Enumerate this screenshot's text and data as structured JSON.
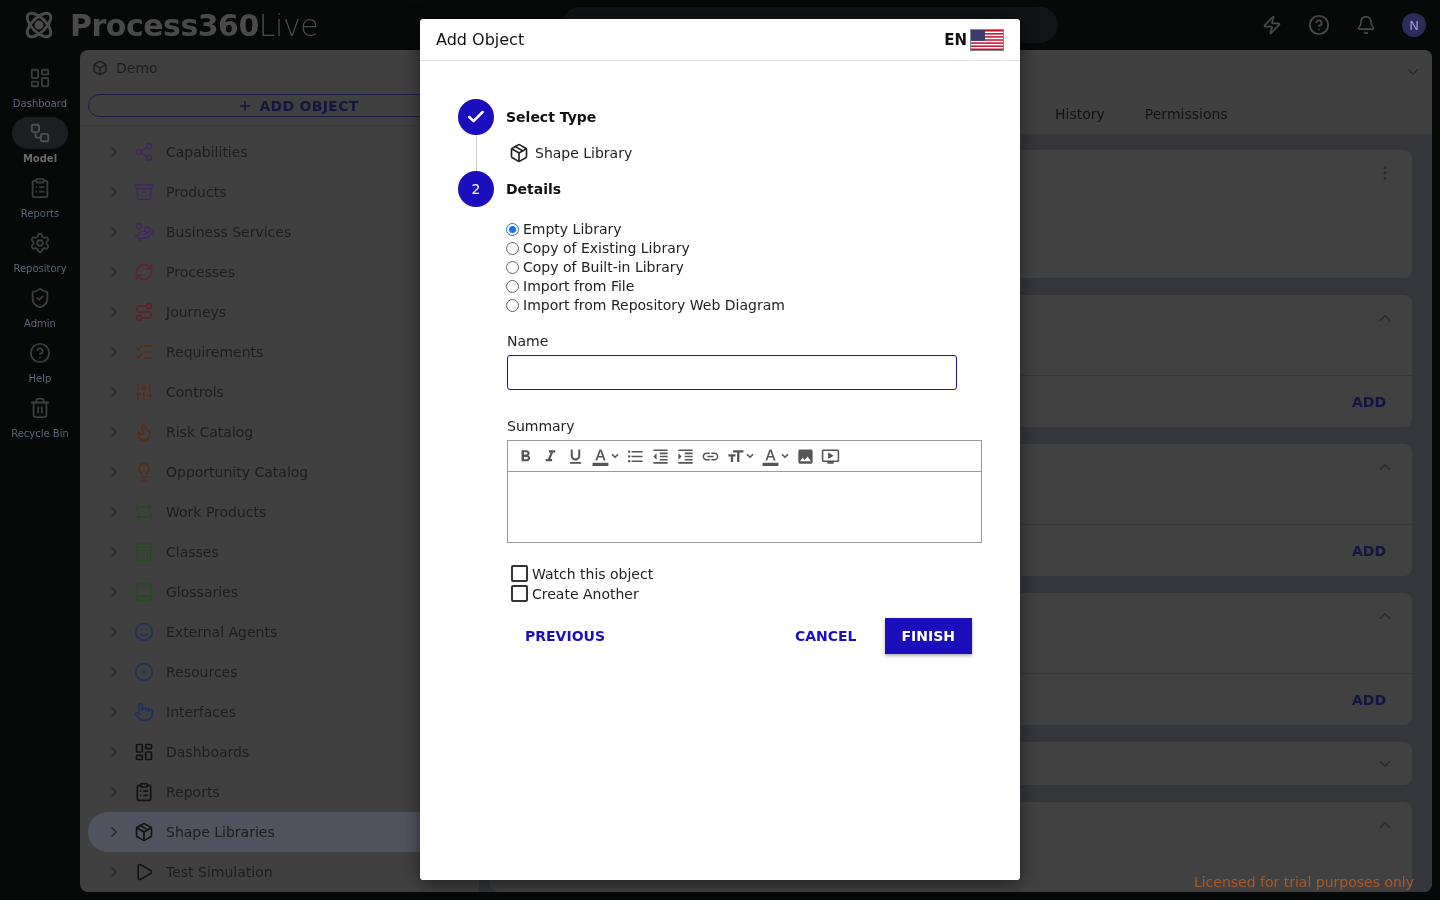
{
  "topbar": {
    "logo": "**Process360**Live",
    "avatar": "N"
  },
  "rail": [
    {
      "label": "Dashboard",
      "selected": false
    },
    {
      "label": "Model",
      "selected": true
    },
    {
      "label": "Reports",
      "selected": false
    },
    {
      "label": "Repository",
      "selected": false
    },
    {
      "label": "Admin",
      "selected": false
    },
    {
      "label": "Help",
      "selected": false
    },
    {
      "label": "Recycle Bin",
      "selected": false
    }
  ],
  "tree": {
    "title": "Demo",
    "add_button": "ADD OBJECT",
    "items": [
      {
        "label": "Capabilities",
        "color": "#3f2a5c",
        "selected": false
      },
      {
        "label": "Products",
        "color": "#3f2a5c",
        "selected": false
      },
      {
        "label": "Business Services",
        "color": "#3f2a5c",
        "selected": false
      },
      {
        "label": "Processes",
        "color": "#5c2230",
        "selected": false
      },
      {
        "label": "Journeys",
        "color": "#5c2230",
        "selected": false
      },
      {
        "label": "Requirements",
        "color": "#5c2a18",
        "selected": false
      },
      {
        "label": "Controls",
        "color": "#5c2a18",
        "selected": false
      },
      {
        "label": "Risk Catalog",
        "color": "#5c2a18",
        "selected": false
      },
      {
        "label": "Opportunity Catalog",
        "color": "#5c2a18",
        "selected": false
      },
      {
        "label": "Work Products",
        "color": "#244a20",
        "selected": false
      },
      {
        "label": "Classes",
        "color": "#244a20",
        "selected": false
      },
      {
        "label": "Glossaries",
        "color": "#244a20",
        "selected": false
      },
      {
        "label": "External Agents",
        "color": "#22305c",
        "selected": false
      },
      {
        "label": "Resources",
        "color": "#22305c",
        "selected": false
      },
      {
        "label": "Interfaces",
        "color": "#22305c",
        "selected": false
      },
      {
        "label": "Dashboards",
        "color": "#111111",
        "selected": false
      },
      {
        "label": "Reports",
        "color": "#111111",
        "selected": false
      },
      {
        "label": "Shape Libraries",
        "color": "#111111",
        "selected": true
      },
      {
        "label": "Test Simulation",
        "color": "#111111",
        "selected": false
      }
    ]
  },
  "detail": {
    "tabs": [
      {
        "label": "History",
        "selected": false
      },
      {
        "label": "Permissions",
        "selected": false
      }
    ],
    "cards": [
      {
        "kind": "menu"
      },
      {
        "kind": "section",
        "expanded": true,
        "action": "ADD"
      },
      {
        "kind": "section",
        "expanded": true,
        "action": "ADD"
      },
      {
        "kind": "section",
        "expanded": true,
        "action": "ADD"
      },
      {
        "kind": "collapsed",
        "expanded": false
      },
      {
        "kind": "section",
        "expanded": true
      }
    ],
    "license": "Licensed for trial purposes only"
  },
  "dialog": {
    "title": "Add Object",
    "language": "EN",
    "steps": [
      {
        "label": "Select Type",
        "done": true,
        "value": "Shape Library"
      },
      {
        "number": "2",
        "label": "Details",
        "done": false
      }
    ],
    "options": [
      {
        "label": "Empty Library",
        "selected": true
      },
      {
        "label": "Copy of Existing Library",
        "selected": false
      },
      {
        "label": "Copy of Built-in Library",
        "selected": false
      },
      {
        "label": "Import from File",
        "selected": false
      },
      {
        "label": "Import from Repository Web Diagram",
        "selected": false
      }
    ],
    "name_label": "Name",
    "summary_label": "Summary",
    "checks": [
      {
        "label": "Watch this object",
        "checked": false
      },
      {
        "label": "Create Another",
        "checked": false
      }
    ],
    "buttons": {
      "previous": "PREVIOUS",
      "cancel": "CANCEL",
      "finish": "FINISH"
    }
  }
}
